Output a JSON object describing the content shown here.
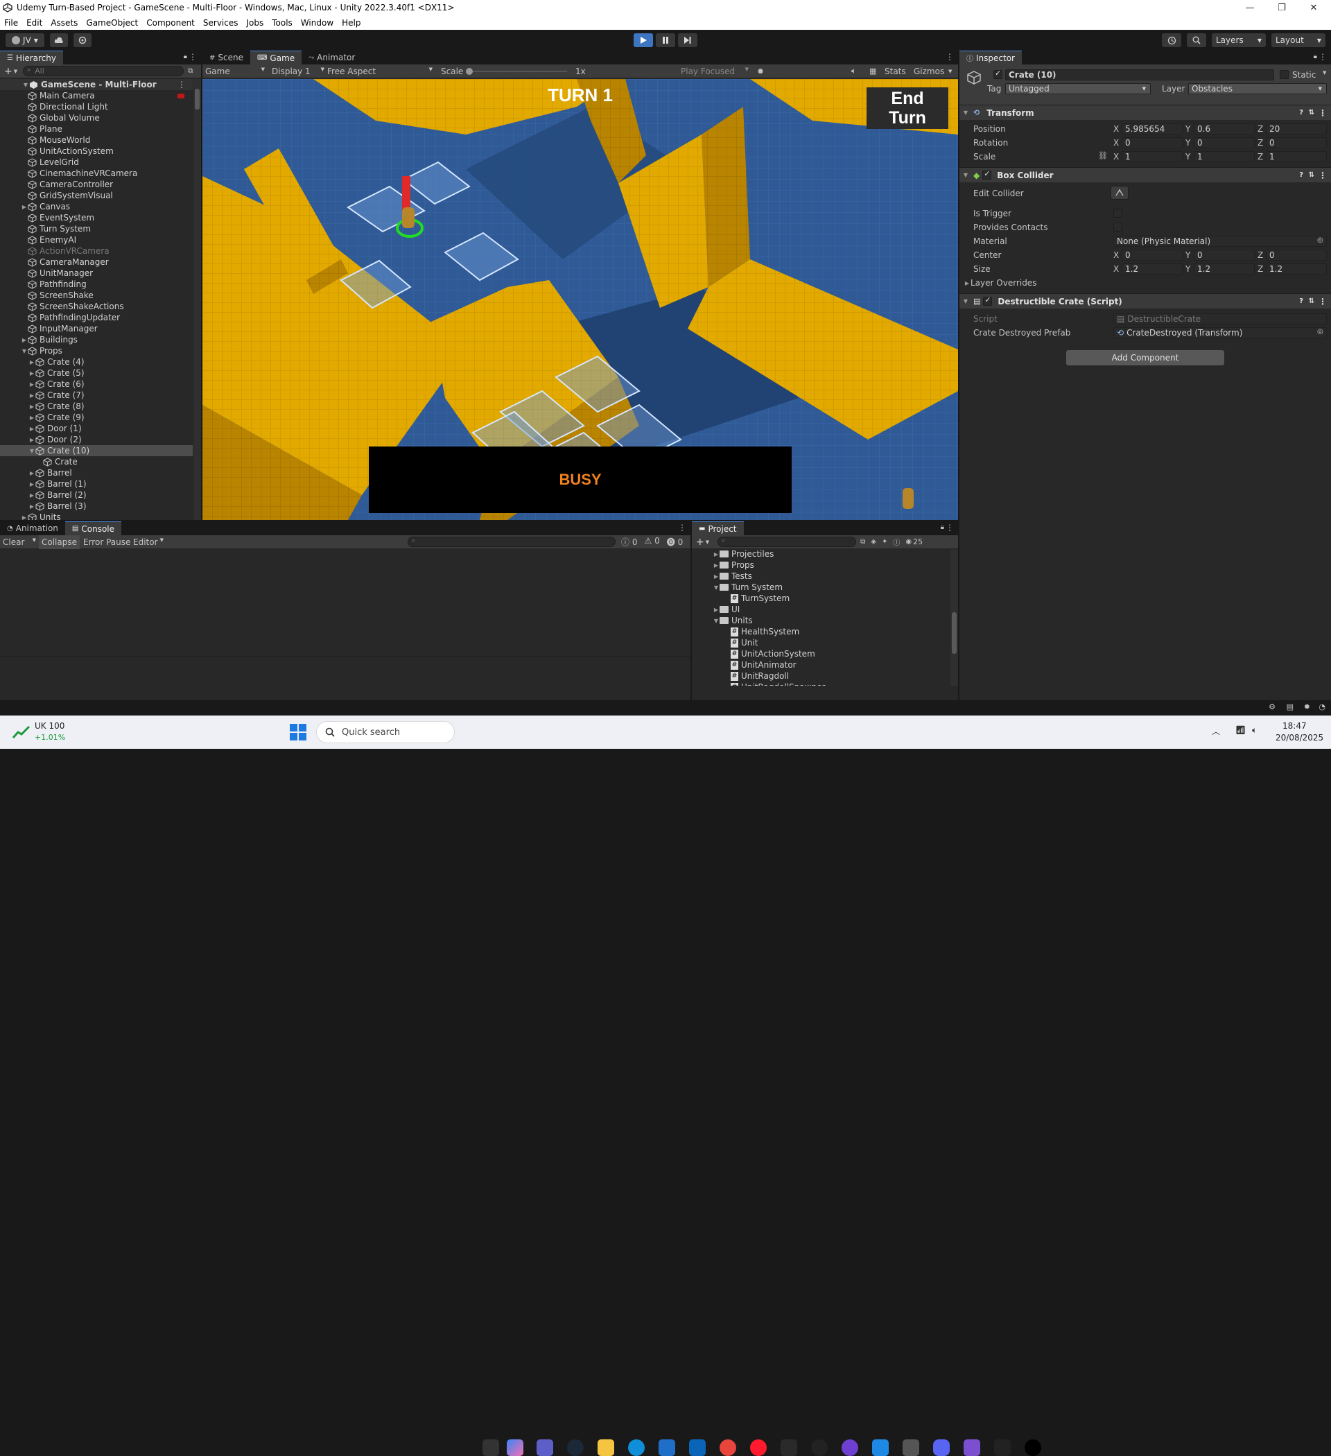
{
  "window": {
    "title": "Udemy Turn-Based Project - GameScene - Multi-Floor - Windows, Mac, Linux - Unity 2022.3.40f1 <DX11>",
    "minimize": "—",
    "maximize": "❐",
    "close": "✕"
  },
  "menu": [
    "File",
    "Edit",
    "Assets",
    "GameObject",
    "Component",
    "Services",
    "Jobs",
    "Tools",
    "Window",
    "Help"
  ],
  "toolbar": {
    "account": "JV",
    "layers": "Layers",
    "layout": "Layout"
  },
  "hierarchy": {
    "tab": "Hierarchy",
    "search_placeholder": "All",
    "scene": "GameScene - Multi-Floor",
    "items": [
      {
        "label": "Main Camera",
        "depth": 1
      },
      {
        "label": "Directional Light",
        "depth": 1
      },
      {
        "label": "Global Volume",
        "depth": 1
      },
      {
        "label": "Plane",
        "depth": 1
      },
      {
        "label": "MouseWorld",
        "depth": 1
      },
      {
        "label": "UnitActionSystem",
        "depth": 1
      },
      {
        "label": "LevelGrid",
        "depth": 1
      },
      {
        "label": "CinemachineVRCamera",
        "depth": 1
      },
      {
        "label": "CameraController",
        "depth": 1
      },
      {
        "label": "GridSystemVisual",
        "depth": 1
      },
      {
        "label": "Canvas",
        "depth": 1,
        "arrow": "▶"
      },
      {
        "label": "EventSystem",
        "depth": 1
      },
      {
        "label": "Turn System",
        "depth": 1
      },
      {
        "label": "EnemyAI",
        "depth": 1
      },
      {
        "label": "ActionVRCamera",
        "depth": 1,
        "dim": true
      },
      {
        "label": "CameraManager",
        "depth": 1
      },
      {
        "label": "UnitManager",
        "depth": 1
      },
      {
        "label": "Pathfinding",
        "depth": 1
      },
      {
        "label": "ScreenShake",
        "depth": 1
      },
      {
        "label": "ScreenShakeActions",
        "depth": 1
      },
      {
        "label": "PathfindingUpdater",
        "depth": 1
      },
      {
        "label": "InputManager",
        "depth": 1
      },
      {
        "label": "Buildings",
        "depth": 1,
        "arrow": "▶"
      },
      {
        "label": "Props",
        "depth": 1,
        "arrow": "▼"
      },
      {
        "label": "Crate (4)",
        "depth": 2,
        "arrow": "▶"
      },
      {
        "label": "Crate (5)",
        "depth": 2,
        "arrow": "▶"
      },
      {
        "label": "Crate (6)",
        "depth": 2,
        "arrow": "▶"
      },
      {
        "label": "Crate (7)",
        "depth": 2,
        "arrow": "▶"
      },
      {
        "label": "Crate (8)",
        "depth": 2,
        "arrow": "▶"
      },
      {
        "label": "Crate (9)",
        "depth": 2,
        "arrow": "▶"
      },
      {
        "label": "Door (1)",
        "depth": 2,
        "arrow": "▶"
      },
      {
        "label": "Door (2)",
        "depth": 2,
        "arrow": "▶"
      },
      {
        "label": "Crate (10)",
        "depth": 2,
        "arrow": "▼",
        "selected": true
      },
      {
        "label": "Crate",
        "depth": 3
      },
      {
        "label": "Barrel",
        "depth": 2,
        "arrow": "▶"
      },
      {
        "label": "Barrel (1)",
        "depth": 2,
        "arrow": "▶"
      },
      {
        "label": "Barrel (2)",
        "depth": 2,
        "arrow": "▶"
      },
      {
        "label": "Barrel (3)",
        "depth": 2,
        "arrow": "▶"
      },
      {
        "label": "Units",
        "depth": 1,
        "arrow": "▶"
      }
    ]
  },
  "view": {
    "tabs": [
      "Scene",
      "Game",
      "Animator"
    ],
    "game_dropdown": "Game",
    "display": "Display 1",
    "aspect": "Free Aspect",
    "scale_label": "Scale",
    "scale_value": "1x",
    "play_mode": "Play Focused",
    "stats": "Stats",
    "gizmos": "Gizmos",
    "turn_text": "TURN 1",
    "end_turn": "End\nTurn",
    "busy_text": "BUSY"
  },
  "inspector": {
    "tab": "Inspector",
    "object_name": "Crate (10)",
    "static_label": "Static",
    "tag_label": "Tag",
    "tag_value": "Untagged",
    "layer_label": "Layer",
    "layer_value": "Obstacles",
    "transform": {
      "title": "Transform",
      "position_label": "Position",
      "rotation_label": "Rotation",
      "scale_label": "Scale",
      "position": [
        "5.985654",
        "0.6",
        "20"
      ],
      "rotation": [
        "0",
        "0",
        "0"
      ],
      "scale": [
        "1",
        "1",
        "1"
      ]
    },
    "box_collider": {
      "title": "Box Collider",
      "edit_collider": "Edit Collider",
      "is_trigger": "Is Trigger",
      "provides_contacts": "Provides Contacts",
      "material_label": "Material",
      "material_value": "None (Physic Material)",
      "center_label": "Center",
      "center": [
        "0",
        "0",
        "0"
      ],
      "size_label": "Size",
      "size": [
        "1.2",
        "1.2",
        "1.2"
      ],
      "layer_overrides": "Layer Overrides"
    },
    "destructible": {
      "title": "Destructible Crate (Script)",
      "script_label": "Script",
      "script_value": "DestructibleCrate",
      "prefab_label": "Crate Destroyed Prefab",
      "prefab_value": "CrateDestroyed (Transform)"
    },
    "add_component": "Add Component",
    "axis": [
      "X",
      "Y",
      "Z"
    ]
  },
  "console": {
    "tabs": [
      "Animation",
      "Console"
    ],
    "clear": "Clear",
    "collapse": "Collapse",
    "error_pause": "Error Pause",
    "editor": "Editor",
    "counts": [
      "0",
      "0",
      "0"
    ]
  },
  "project": {
    "tab": "Project",
    "count": "25",
    "items": [
      {
        "label": "Projectiles",
        "depth": 1,
        "type": "folder",
        "arrow": "▶"
      },
      {
        "label": "Props",
        "depth": 1,
        "type": "folder",
        "arrow": "▶"
      },
      {
        "label": "Tests",
        "depth": 1,
        "type": "folder",
        "arrow": "▶"
      },
      {
        "label": "Turn System",
        "depth": 1,
        "type": "folder",
        "arrow": "▼"
      },
      {
        "label": "TurnSystem",
        "depth": 2,
        "type": "script"
      },
      {
        "label": "UI",
        "depth": 1,
        "type": "folder",
        "arrow": "▶"
      },
      {
        "label": "Units",
        "depth": 1,
        "type": "folder",
        "arrow": "▼"
      },
      {
        "label": "HealthSystem",
        "depth": 2,
        "type": "script"
      },
      {
        "label": "Unit",
        "depth": 2,
        "type": "script"
      },
      {
        "label": "UnitActionSystem",
        "depth": 2,
        "type": "script"
      },
      {
        "label": "UnitAnimator",
        "depth": 2,
        "type": "script"
      },
      {
        "label": "UnitRagdoll",
        "depth": 2,
        "type": "script"
      },
      {
        "label": "UnitRagdollSpawner",
        "depth": 2,
        "type": "script"
      }
    ]
  },
  "taskbar": {
    "stock_name": "UK 100",
    "stock_change": "+1.01%",
    "search_placeholder": "Quick search",
    "time": "18:47",
    "date": "20/08/2025"
  },
  "colors": {
    "accent": "#4b88e0",
    "wall": "#e0a800",
    "floor": "#2f5a96",
    "busy_text": "#f0821e"
  }
}
